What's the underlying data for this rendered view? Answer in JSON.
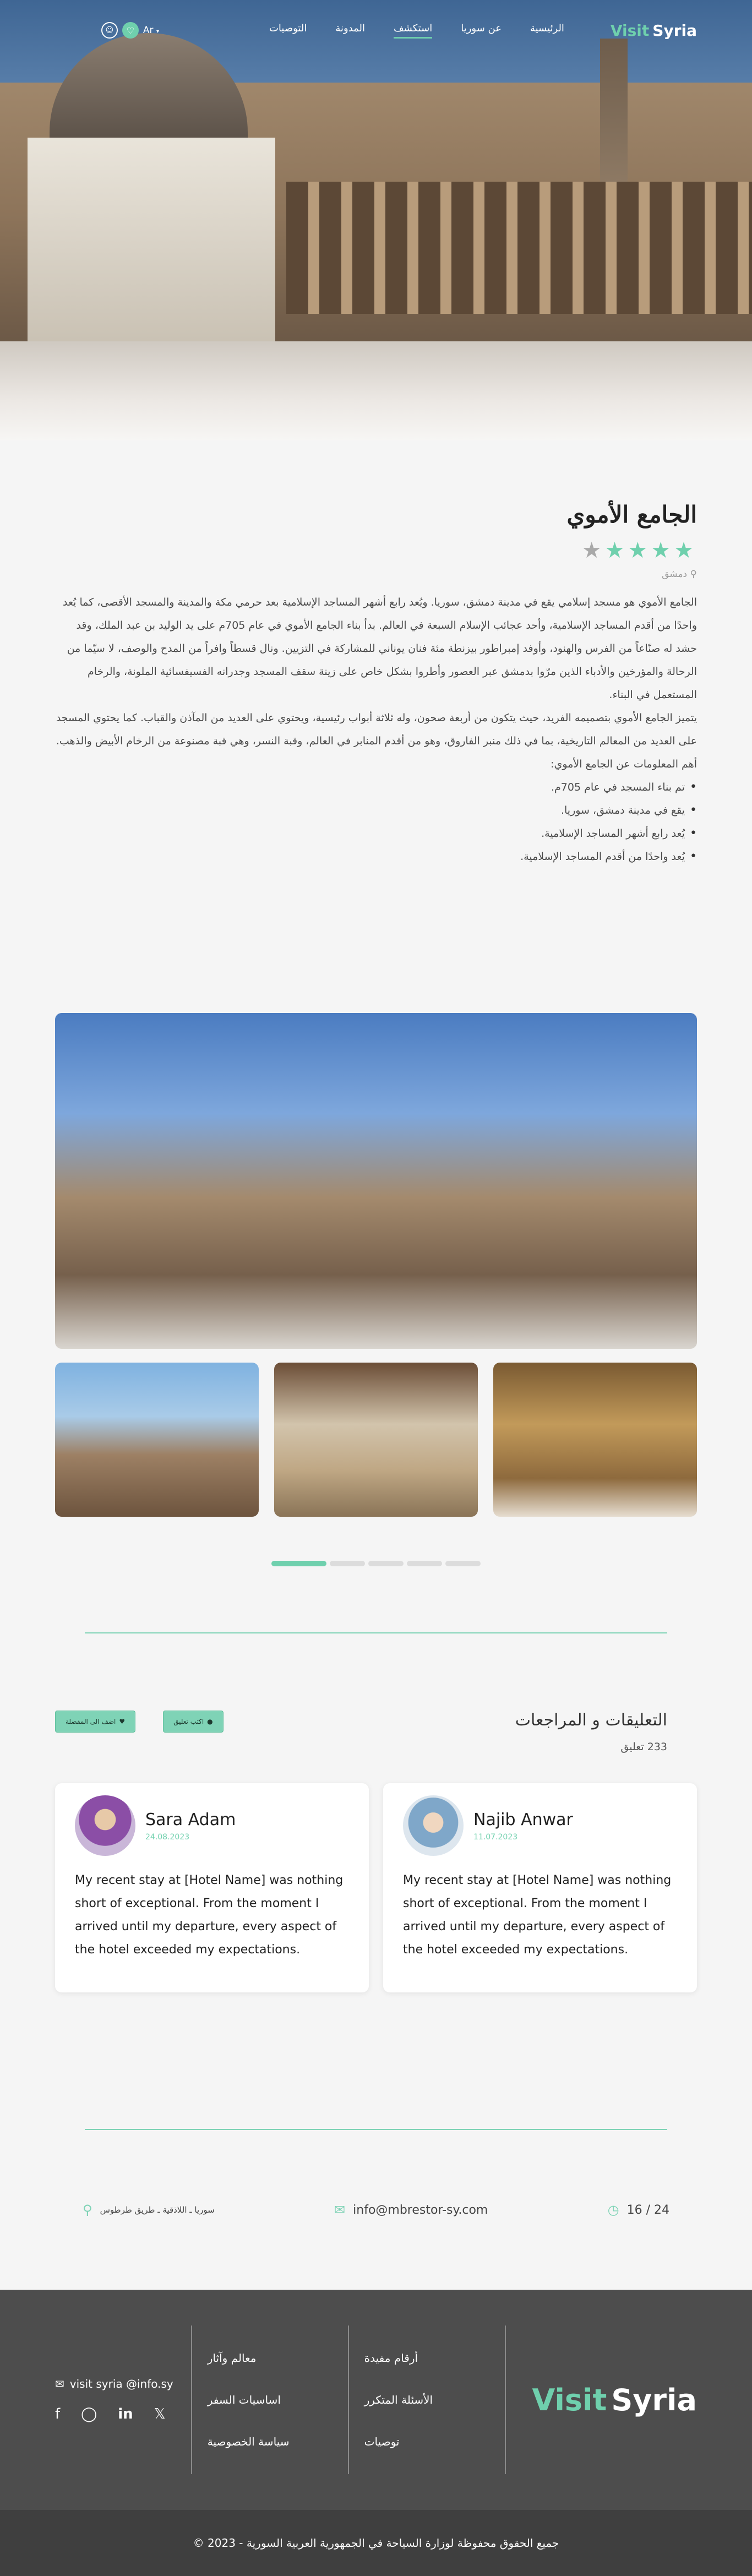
{
  "nav": {
    "logo_visit": "Visit",
    "logo_syria": "Syria",
    "links": [
      "الرئيسية",
      "عن سوريا",
      "استكشف",
      "المدونة",
      "التوصيات"
    ],
    "active": "استكشف",
    "lang": "Ar"
  },
  "details": {
    "title": "الجامع الأموي",
    "rating": 4,
    "location": "دمشق",
    "paragraphs": [
      "الجامع الأموي هو مسجد إسلامي يقع في مدينة دمشق، سوريا. ويُعد رابع أشهر المساجد الإسلامية بعد حرمي مكة والمدينة والمسجد الأقصى، كما يُعد واحدًا من أقدم المساجد الإسلامية، وأحد عجائب الإسلام السبعة في العالم. بدأ بناء الجامع الأموي في عام 705م على يد الوليد بن عبد الملك، وقد حشد له صنّاعاً من الفرس والهنود، وأوفد إمبراطور بيزنطة مئة فنان يوناني للمشاركة في التزيين. ونال قسطاً وافراً من المدح والوصف، لا سيّما من الرحالة والمؤرخين والأدباء الذين مرّوا بدمشق عبر العصور وأطروا بشكل خاص على زينة سقف المسجد وجدرانه الفسيفسائية الملونة، والرخام المستعمل في البناء.",
      "يتميز الجامع الأموي بتصميمه الفريد، حيث يتكون من أربعة صحون، وله ثلاثة أبواب رئيسية، ويحتوي على العديد من المآذن والقباب. كما يحتوي المسجد على العديد من المعالم التاريخية، بما في ذلك منبر الفاروق، وهو من أقدم المنابر في العالم، وقبة النسر، وهي قبة مصنوعة من الرخام الأبيض والذهب.",
      "أهم المعلومات عن الجامع الأموي:"
    ],
    "bullets": [
      "تم بناء المسجد في عام 705م.",
      "يقع في مدينة دمشق، سوريا.",
      "يُعد رابع أشهر المساجد الإسلامية.",
      "يُعد واحدًا من أقدم المساجد الإسلامية."
    ]
  },
  "gallery": {
    "slides": 5,
    "active_slide": 1
  },
  "comments": {
    "title": "التعليقات و المراجعات",
    "count": "233 تعليق",
    "add_comment": "اكتب تعليق",
    "add_favorite": "اضف الى المفضلة",
    "items": [
      {
        "name": "Sara Adam",
        "date": "24.08.2023",
        "text": "My recent stay at [Hotel Name] was nothing short of exceptional. From the moment I arrived until my departure, every aspect of the hotel exceeded my expectations."
      },
      {
        "name": "Najib Anwar",
        "date": "11.07.2023",
        "text": "My recent stay at [Hotel Name] was nothing short of exceptional. From the moment I arrived until my departure, every aspect of the hotel exceeded my expectations."
      }
    ]
  },
  "contact": {
    "hours": "16 / 24",
    "email": "info@mbrestor-sy.com",
    "address": "سوريا ـ اللاذقية ـ طريق طرطوس"
  },
  "footer": {
    "email": "visit syria @info.sy",
    "col1": [
      "معالم وآثار",
      "اساسيات السفر",
      "سياسة الخصوصية"
    ],
    "col2": [
      "أرقام مفيدة",
      "الأسئلة المتكرر",
      "توصيات"
    ],
    "logo_visit": "Visit",
    "logo_syria": "Syria",
    "copyright": "جميع الحقوق محفوظة لوزارة السياحة في الجمهورية العربية السورية - 2023 ©"
  },
  "colors": {
    "accent": "#6fd0ad",
    "footer_bg": "#4d4d4d"
  }
}
